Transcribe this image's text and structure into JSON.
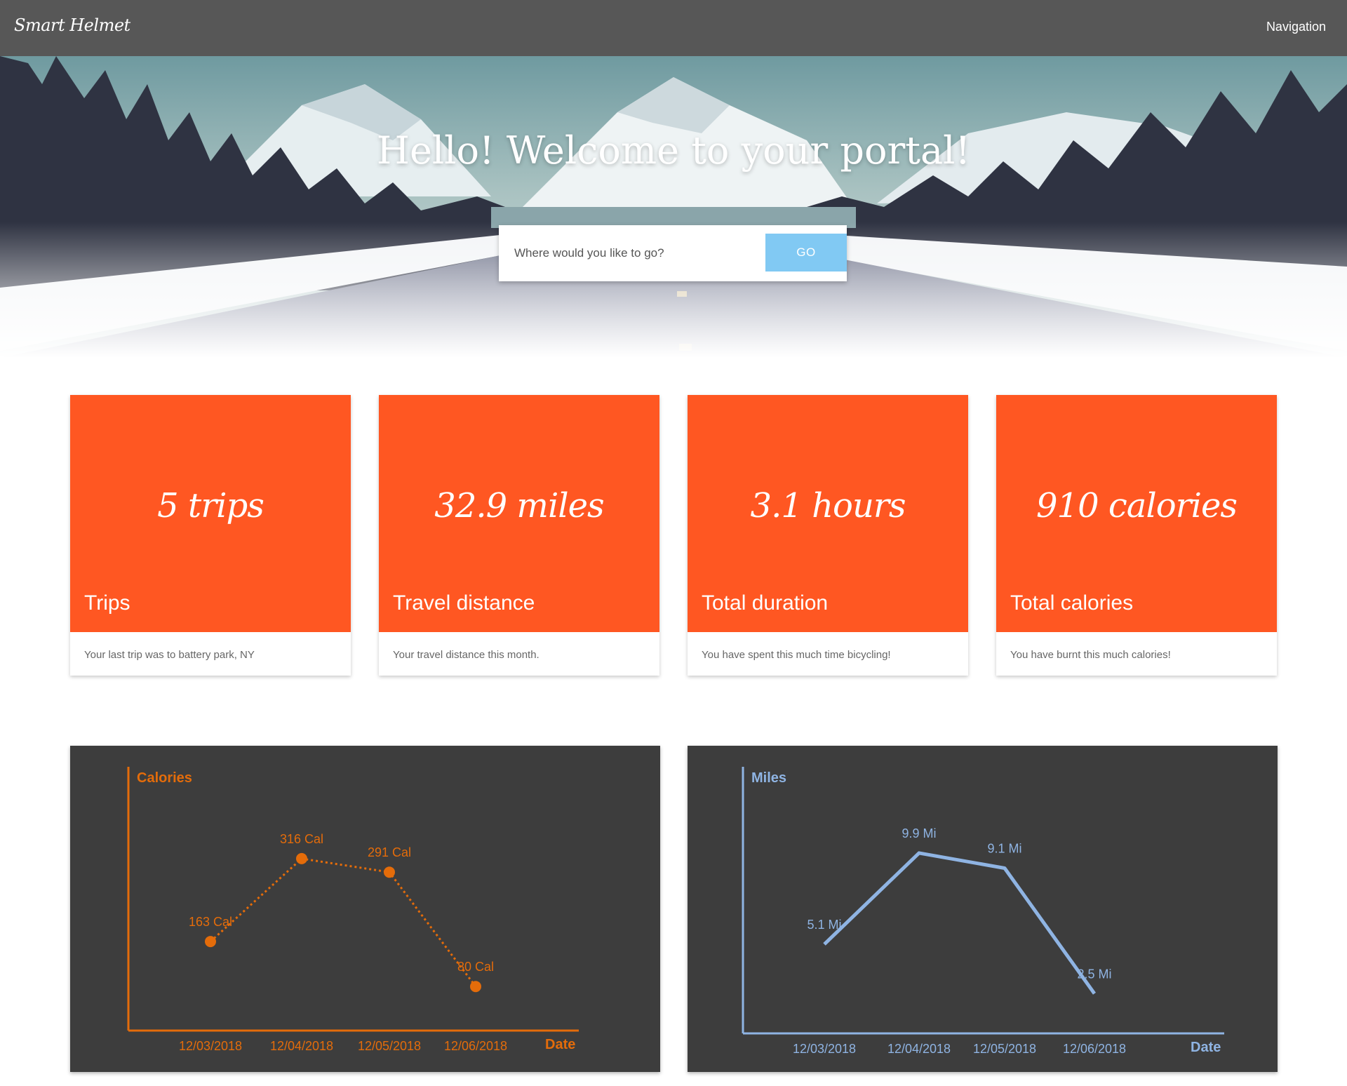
{
  "navbar": {
    "brand": "Smart Helmet",
    "nav_label": "Navigation"
  },
  "hero": {
    "title": "Hello! Welcome to your portal!",
    "search_placeholder": "Where would you like to go?",
    "go_label": "GO"
  },
  "cards": [
    {
      "value": "5 trips",
      "title": "Trips",
      "desc": "Your last trip was to battery park, NY"
    },
    {
      "value": "32.9 miles",
      "title": "Travel distance",
      "desc": "Your travel distance this month."
    },
    {
      "value": "3.1 hours",
      "title": "Total duration",
      "desc": "You have spent this much time bicycling!"
    },
    {
      "value": "910 calories",
      "title": "Total calories",
      "desc": "You have burnt this much calories!"
    }
  ],
  "colors": {
    "accent_orange": "#ff5722",
    "go_button": "#81c9f3",
    "navbar": "#575757",
    "chart_bg": "#3d3d3d",
    "calories_line": "#e46c0a",
    "miles_line": "#8fb4e3"
  },
  "chart_data": [
    {
      "type": "line",
      "title": "",
      "ylabel": "Calories",
      "xlabel": "Date",
      "categories": [
        "12/03/2018",
        "12/04/2018",
        "12/05/2018",
        "12/06/2018"
      ],
      "series": [
        {
          "values": [
            163,
            316,
            291,
            80
          ]
        }
      ],
      "data_labels": [
        "163 Cal",
        "316 Cal",
        "291 Cal",
        "80 Cal"
      ],
      "ylim": [
        0,
        400
      ],
      "grid": false,
      "line_style": "dotted",
      "markers": true
    },
    {
      "type": "line",
      "title": "",
      "ylabel": "Miles",
      "xlabel": "Date",
      "categories": [
        "12/03/2018",
        "12/04/2018",
        "12/05/2018",
        "12/06/2018"
      ],
      "series": [
        {
          "values": [
            5.1,
            9.9,
            9.1,
            2.5
          ]
        }
      ],
      "data_labels": [
        "5.1 Mi",
        "9.9 Mi",
        "9.1 Mi",
        "2.5 Mi"
      ],
      "ylim": [
        0,
        12
      ],
      "grid": false,
      "line_style": "solid",
      "markers": false
    }
  ]
}
